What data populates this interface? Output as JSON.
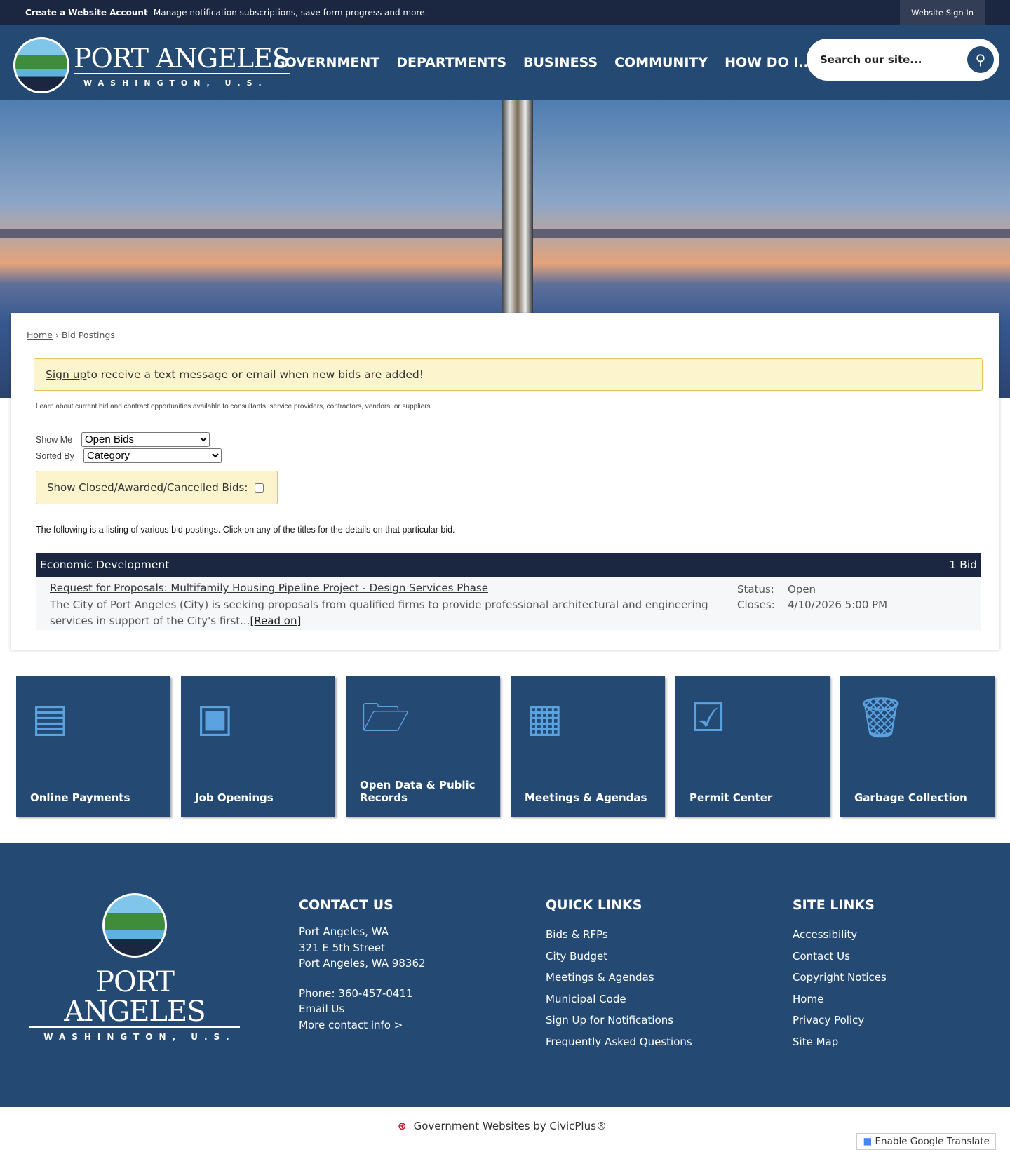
{
  "topbar": {
    "account_link": "Create a Website Account",
    "account_desc": " - Manage notification subscriptions, save form progress and more.",
    "signin": "Website Sign In"
  },
  "logo": {
    "name": "PORT ANGELES",
    "sub": "WASHINGTON, U.S."
  },
  "nav": [
    "GOVERNMENT",
    "DEPARTMENTS",
    "BUSINESS",
    "COMMUNITY",
    "HOW DO I..."
  ],
  "search": {
    "placeholder": "Search our site..."
  },
  "breadcrumb": {
    "home": "Home",
    "sep": " › ",
    "current": "Bid Postings"
  },
  "signup": {
    "link": "Sign up",
    "text": " to receive a text message or email when new bids are added!"
  },
  "intro": "Learn about current bid and contract opportunities available to consultants, service providers, contractors, vendors, or suppliers.",
  "filters": {
    "show_me_label": "Show Me",
    "show_me_value": "Open Bids",
    "sorted_by_label": "Sorted By",
    "sorted_by_value": "Category",
    "closed_label": "Show Closed/Awarded/Cancelled Bids:"
  },
  "listing_text": "The following is a listing of various bid postings. Click on any of the titles for the details on that particular bid.",
  "category": {
    "name": "Economic Development",
    "count": "1 Bid"
  },
  "bid": {
    "title": "Request for Proposals: Multifamily Housing Pipeline Project - Design Services Phase",
    "desc": "The City of Port Angeles (City) is seeking proposals from qualified firms to provide professional architectural and engineering services in support of the City's first...",
    "read_on": "[Read on]",
    "status_label": "Status:",
    "status": "Open",
    "closes_label": "Closes:",
    "closes": "4/10/2026 5:00 PM"
  },
  "tiles": [
    {
      "label": "Online Payments",
      "icon": "payment-icon"
    },
    {
      "label": "Job Openings",
      "icon": "briefcase-icon"
    },
    {
      "label": "Open Data & Public Records",
      "icon": "folder-icon"
    },
    {
      "label": "Meetings & Agendas",
      "icon": "calendar-icon"
    },
    {
      "label": "Permit Center",
      "icon": "clipboard-icon"
    },
    {
      "label": "Garbage Collection",
      "icon": "trash-icon"
    }
  ],
  "footer": {
    "contact": {
      "title": "CONTACT US",
      "lines": [
        "Port Angeles, WA",
        "321 E 5th Street",
        "Port Angeles, WA 98362"
      ],
      "phone": "Phone: 360-457-0411",
      "email": "Email Us",
      "more": "More contact info >"
    },
    "quick": {
      "title": "QUICK LINKS",
      "links": [
        "Bids & RFPs",
        "City Budget",
        "Meetings & Agendas",
        "Municipal Code",
        "Sign Up for Notifications",
        "Frequently Asked Questions"
      ]
    },
    "site": {
      "title": "SITE LINKS",
      "links": [
        "Accessibility",
        "Contact Us",
        "Copyright Notices",
        "Home",
        "Privacy Policy",
        "Site Map"
      ]
    }
  },
  "bottom": {
    "civic": "Government Websites by CivicPlus®",
    "translate": "Enable Google Translate"
  }
}
